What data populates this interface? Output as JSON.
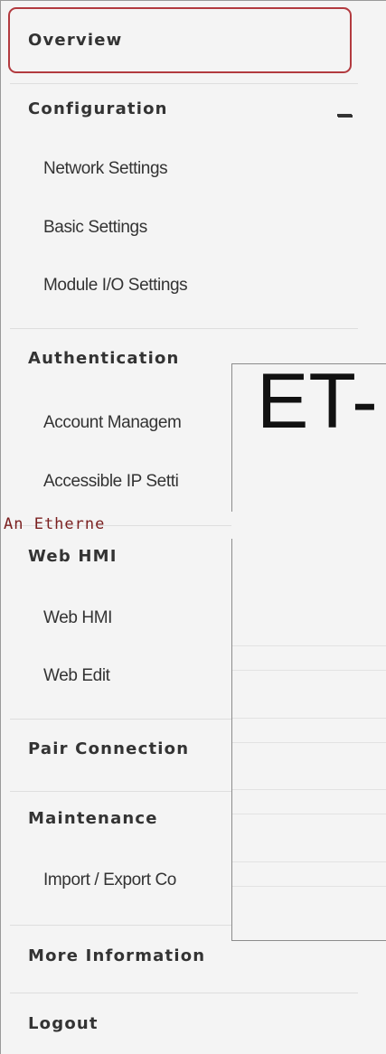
{
  "nav": {
    "overview": "Overview",
    "configuration": {
      "label": "Configuration",
      "toggle": "−",
      "items": [
        "Network Settings",
        "Basic Settings",
        "Module I/O Settings"
      ]
    },
    "authentication": {
      "label": "Authentication",
      "items": [
        "Account Managem",
        "Accessible IP Setti"
      ]
    },
    "web_hmi": {
      "label": "Web HMI",
      "items": [
        "Web HMI",
        "Web Edit"
      ]
    },
    "pair_connection": "Pair Connection",
    "maintenance": {
      "label": "Maintenance",
      "items": [
        "Import / Export Co"
      ]
    },
    "more_information": "More Information",
    "logout": "Logout"
  },
  "overlay": {
    "title": "ET-",
    "subtitle": "An Etherne"
  },
  "colors": {
    "highlight_border": "#b23a3f",
    "sidebar_bg": "#f4f4f4",
    "subtitle_text": "#7a1f1f"
  }
}
